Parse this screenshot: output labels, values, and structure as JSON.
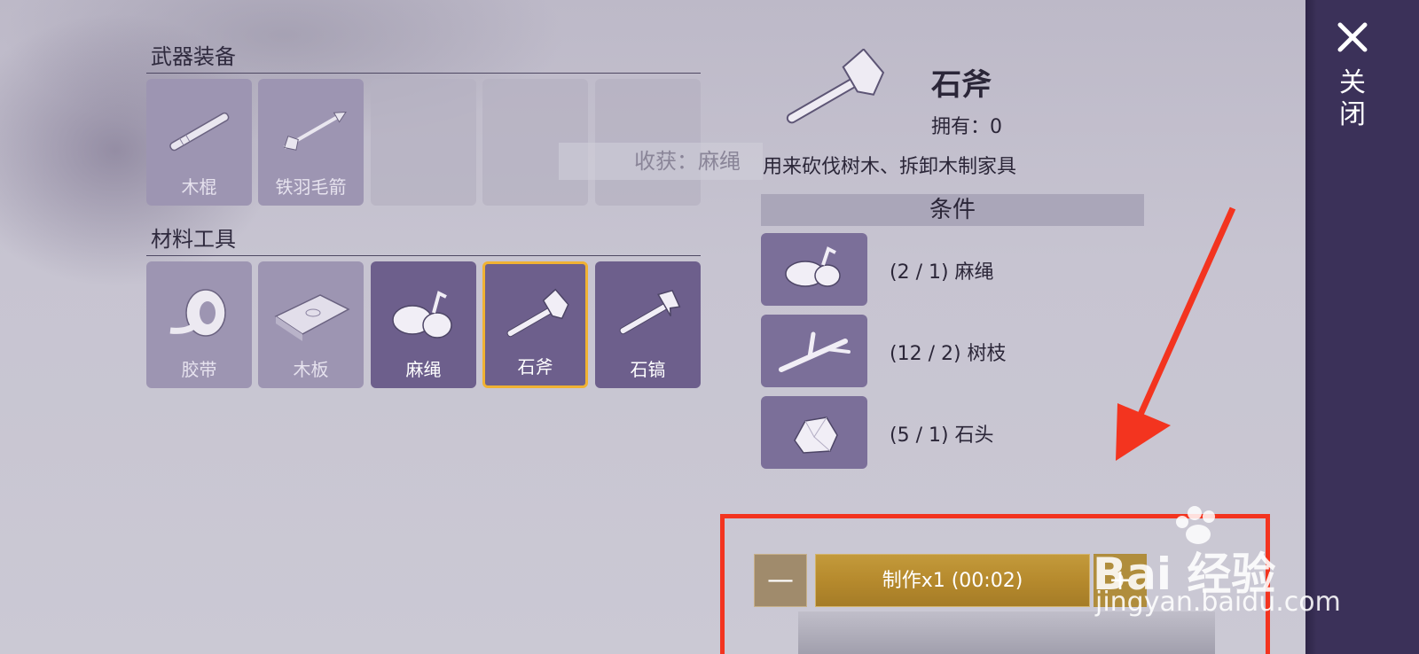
{
  "sections": {
    "weapons_title": "武器装备",
    "materials_title": "材料工具"
  },
  "weapons": [
    {
      "label": "木棍",
      "icon": "wooden-stick-icon"
    },
    {
      "label": "铁羽毛箭",
      "icon": "arrow-icon"
    },
    {
      "label": "",
      "icon": ""
    },
    {
      "label": "",
      "icon": ""
    },
    {
      "label": "",
      "icon": ""
    }
  ],
  "materials": [
    {
      "label": "胶带",
      "icon": "tape-icon"
    },
    {
      "label": "木板",
      "icon": "wood-plank-icon"
    },
    {
      "label": "麻绳",
      "icon": "rope-icon"
    },
    {
      "label": "石斧",
      "icon": "stone-axe-icon"
    },
    {
      "label": "石镐",
      "icon": "stone-pickaxe-icon"
    }
  ],
  "harvest_text": "收获：麻绳",
  "detail": {
    "title": "石斧",
    "owned": "拥有：0",
    "description": "用来砍伐树木、拆卸木制家具",
    "conditions_header": "条件",
    "conditions": [
      {
        "text": "(2 / 1) 麻绳",
        "icon": "rope-icon"
      },
      {
        "text": "(12 / 2) 树枝",
        "icon": "branch-icon"
      },
      {
        "text": "(5 / 1) 石头",
        "icon": "stone-icon"
      }
    ]
  },
  "sidebar": {
    "close_label": "关闭"
  },
  "craft": {
    "minus": "—",
    "button": "制作x1 (00:02)",
    "plus": "+"
  },
  "watermark": {
    "brand": "Bai 经验",
    "url": "jingyan.baidu.com"
  },
  "colors": {
    "accent_gold": "#b68a2d",
    "selected_border": "#f0b233",
    "annotation_red": "#f3341f",
    "sidebar": "#3b3159"
  }
}
